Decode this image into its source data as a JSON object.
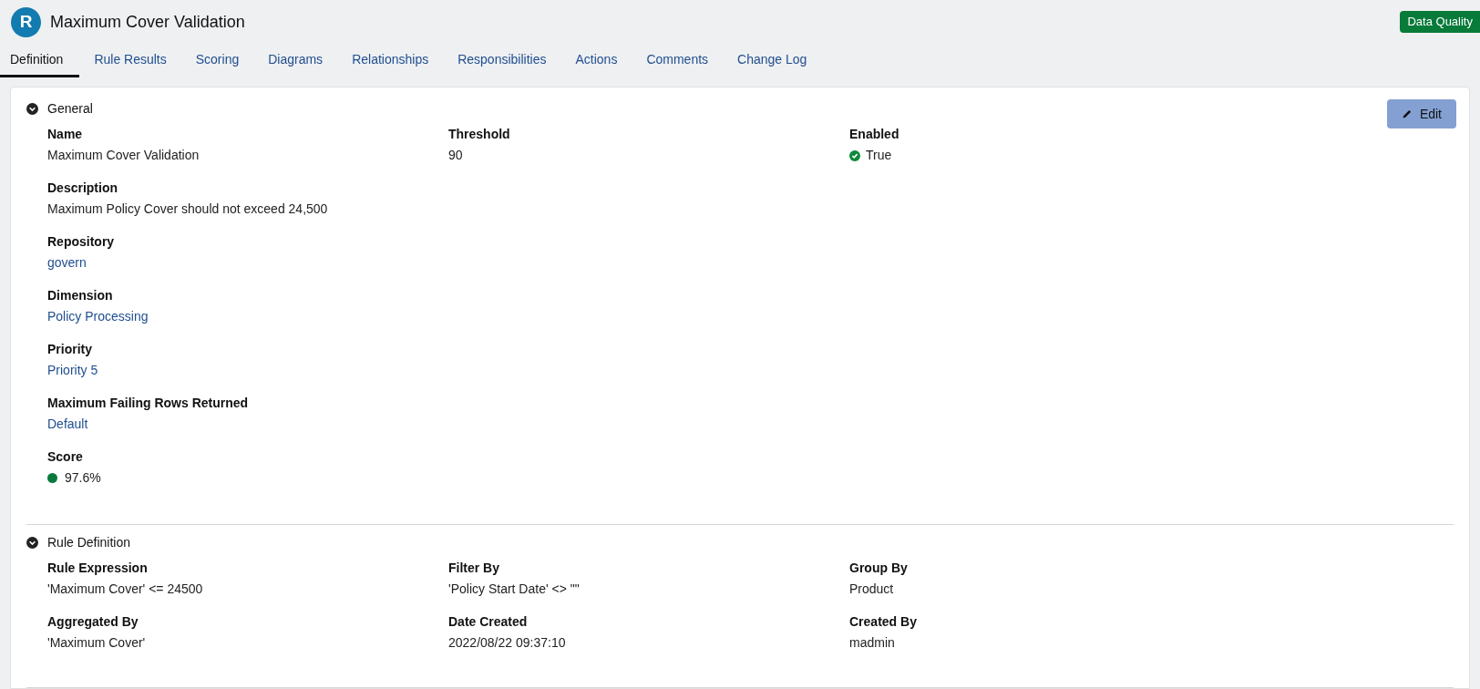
{
  "header": {
    "logo_letter": "R",
    "title": "Maximum Cover Validation",
    "badge": "Data Quality"
  },
  "tabs": [
    {
      "label": "Definition",
      "selected": true
    },
    {
      "label": "Rule Results",
      "selected": false
    },
    {
      "label": "Scoring",
      "selected": false
    },
    {
      "label": "Diagrams",
      "selected": false
    },
    {
      "label": "Relationships",
      "selected": false
    },
    {
      "label": "Responsibilities",
      "selected": false
    },
    {
      "label": "Actions",
      "selected": false
    },
    {
      "label": "Comments",
      "selected": false
    },
    {
      "label": "Change Log",
      "selected": false
    }
  ],
  "edit_button": "Edit",
  "sections": [
    {
      "title": "General",
      "expanded": true,
      "rows": [
        [
          {
            "label": "Name",
            "value": "Maximum Cover Validation",
            "kind": "text"
          },
          {
            "label": "Threshold",
            "value": "90",
            "kind": "text"
          },
          {
            "label": "Enabled",
            "value": "True",
            "kind": "check"
          }
        ],
        [
          {
            "label": "Description",
            "value": "Maximum Policy Cover should not exceed 24,500",
            "kind": "text"
          }
        ],
        [
          {
            "label": "Repository",
            "value": "govern",
            "kind": "link"
          }
        ],
        [
          {
            "label": "Dimension",
            "value": "Policy Processing",
            "kind": "link"
          }
        ],
        [
          {
            "label": "Priority",
            "value": "Priority 5",
            "kind": "link"
          }
        ],
        [
          {
            "label": "Maximum Failing Rows Returned",
            "value": "Default",
            "kind": "link"
          }
        ],
        [
          {
            "label": "Score",
            "value": "97.6%",
            "kind": "score",
            "color": "#0a7a3c"
          }
        ]
      ]
    },
    {
      "title": "Rule Definition",
      "expanded": true,
      "rows": [
        [
          {
            "label": "Rule Expression",
            "value": "'Maximum Cover' <= 24500",
            "kind": "text"
          },
          {
            "label": "Filter By",
            "value": "'Policy Start Date' <> \"\"",
            "kind": "text"
          },
          {
            "label": "Group By",
            "value": "Product",
            "kind": "text"
          }
        ],
        [
          {
            "label": "Aggregated By",
            "value": "'Maximum Cover'",
            "kind": "text"
          },
          {
            "label": "Date Created",
            "value": "2022/08/22 09:37:10",
            "kind": "text"
          },
          {
            "label": "Created By",
            "value": "madmin",
            "kind": "text"
          }
        ]
      ]
    }
  ]
}
